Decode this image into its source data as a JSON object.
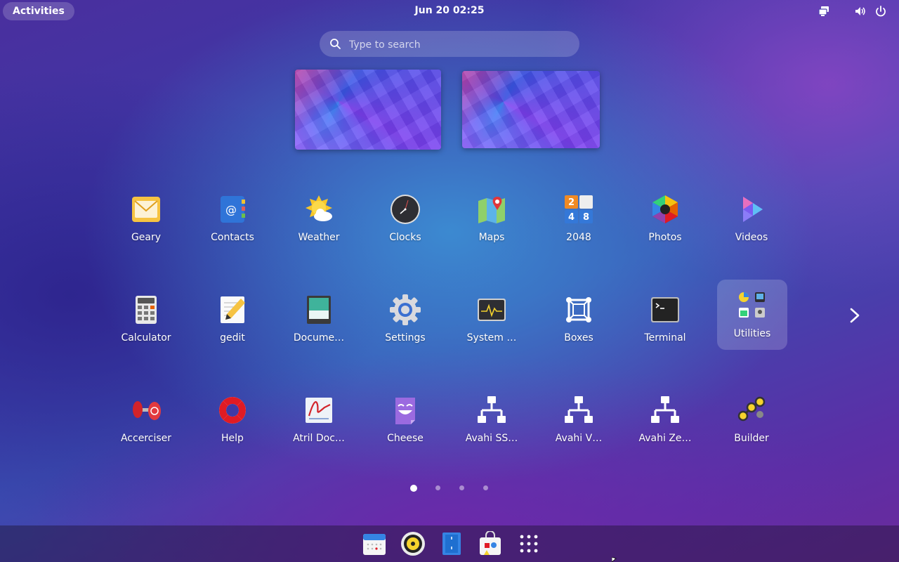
{
  "topbar": {
    "activities_label": "Activities",
    "clock": "Jun 20  02:25",
    "tray": [
      "screen-share-icon",
      "volume-icon",
      "power-icon"
    ]
  },
  "search": {
    "placeholder": "Type to search"
  },
  "apps": {
    "row1": [
      "Geary",
      "Contacts",
      "Weather",
      "Clocks",
      "Maps",
      "2048",
      "Photos",
      "Videos"
    ],
    "row2": [
      "Calculator",
      "gedit",
      "Docume…",
      "Settings",
      "System …",
      "Boxes",
      "Terminal",
      "Utilities"
    ],
    "row3": [
      "Accerciser",
      "Help",
      "Atril Doc…",
      "Cheese",
      "Avahi SS…",
      "Avahi V…",
      "Avahi Ze…",
      "Builder"
    ]
  },
  "tile_2048_digits": [
    "2",
    "4",
    "8"
  ],
  "pagination": {
    "pages": 4,
    "current": 1
  },
  "dock": [
    "calendar-icon",
    "rhythmbox-icon",
    "files-icon",
    "software-icon",
    "show-apps-icon"
  ],
  "colors": {
    "accent": "#3584e4",
    "panel_chip": "rgba(255,255,255,0.18)"
  }
}
